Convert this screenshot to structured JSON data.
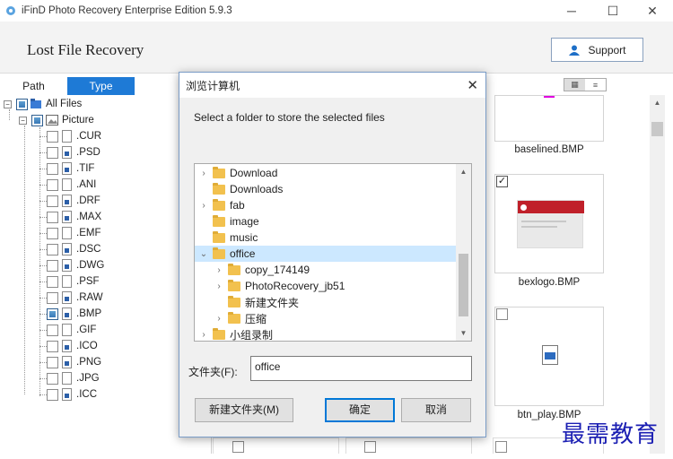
{
  "window": {
    "title": "iFinD Photo Recovery Enterprise Edition 5.9.3",
    "minimize": "─",
    "maximize": "☐",
    "close": "✕"
  },
  "header": {
    "app_title": "Lost File Recovery",
    "support_label": "Support"
  },
  "left_panel": {
    "tabs": [
      {
        "label": "Path"
      },
      {
        "label": "Type"
      }
    ],
    "tree": {
      "root": "All Files",
      "picture": "Picture",
      "extensions": [
        ".CUR",
        ".PSD",
        ".TIF",
        ".ANI",
        ".DRF",
        ".MAX",
        ".EMF",
        ".DSC",
        ".DWG",
        ".PSF",
        ".RAW",
        ".BMP",
        ".GIF",
        ".ICO",
        ".PNG",
        ".JPG",
        ".ICC"
      ]
    }
  },
  "right_panel": {
    "thumbnails": [
      {
        "label": "baselined.BMP"
      },
      {
        "label": "bexlogo.BMP"
      },
      {
        "label": "btn_play.BMP"
      }
    ],
    "view_grid_icon": "grid-view-icon",
    "view_list_icon": "list-view-icon"
  },
  "dialog": {
    "title": "浏览计算机",
    "message": "Select a folder to store the selected files",
    "folders": [
      {
        "name": "Download",
        "expandable": true,
        "level": 0
      },
      {
        "name": "Downloads",
        "expandable": false,
        "level": 0
      },
      {
        "name": "fab",
        "expandable": true,
        "level": 0
      },
      {
        "name": "image",
        "expandable": false,
        "level": 0
      },
      {
        "name": "music",
        "expandable": false,
        "level": 0
      },
      {
        "name": "office",
        "expandable": true,
        "expanded": true,
        "selected": true,
        "level": 0
      },
      {
        "name": "copy_174149",
        "expandable": true,
        "level": 1
      },
      {
        "name": "PhotoRecovery_jb51",
        "expandable": true,
        "level": 1
      },
      {
        "name": "新建文件夹",
        "expandable": false,
        "level": 1
      },
      {
        "name": "压缩",
        "expandable": true,
        "level": 1
      },
      {
        "name": "小组录制",
        "expandable": true,
        "level": 0
      }
    ],
    "folder_label": "文件夹(F):",
    "folder_value": "office",
    "new_folder_button": "新建文件夹(M)",
    "ok_button": "确定",
    "cancel_button": "取消"
  },
  "watermark": "最需教育",
  "colors": {
    "accent": "#1e7ad6",
    "selection": "#cce8ff",
    "folder": "#f2c14e",
    "watermark": "#1b1fb3"
  }
}
